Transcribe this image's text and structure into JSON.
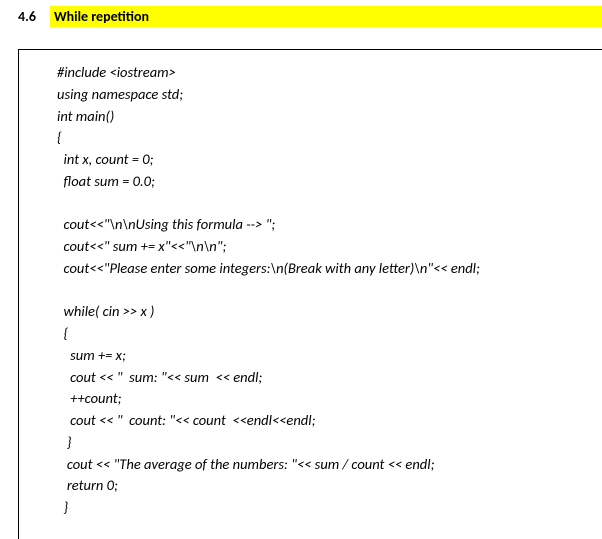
{
  "header": {
    "number": "4.6",
    "title": "While repetition"
  },
  "code": {
    "lines": [
      "#include <iostream>",
      "using namespace std;",
      "int main()",
      "{",
      "  int x, count = 0;",
      "  float sum = 0.0;",
      "",
      "  cout<<\"\\n\\nUsing this formula --> \";",
      "  cout<<\" sum += x\"<<\"\\n\\n\";",
      "  cout<<\"Please enter some integers:\\n(Break with any letter)\\n\"<< endl;",
      "",
      "  while( cin >> x )",
      "  {",
      "    sum += x;",
      "    cout << \"  sum: \"<< sum  << endl;",
      "    ++count;",
      "    cout << \"  count: \"<< count  <<endl<<endl;",
      "   }",
      "   cout << \"The average of the numbers: \"<< sum / count << endl;",
      "   return 0;",
      "  }"
    ]
  }
}
